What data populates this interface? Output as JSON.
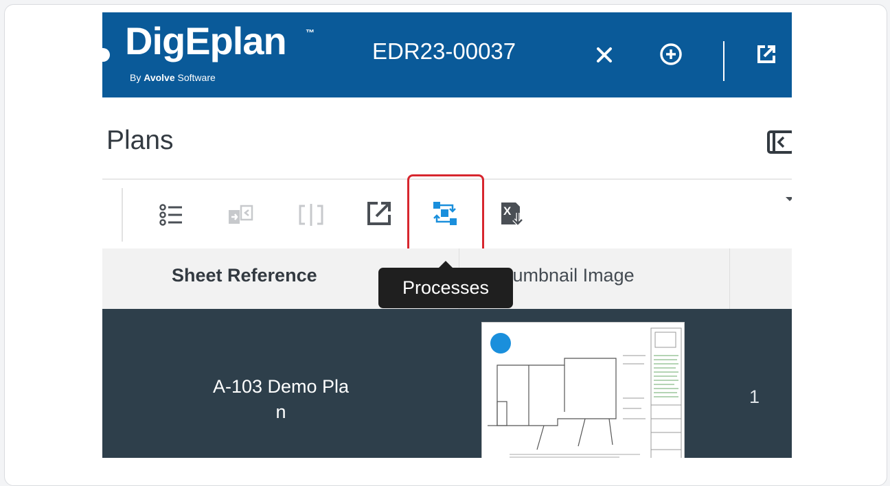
{
  "app": {
    "logo_name": "DigEplan",
    "logo_tm": "™",
    "logo_by_prefix": "By ",
    "logo_by_brand": "Avolve",
    "logo_by_suffix": " Software",
    "record_id": "EDR23-00037"
  },
  "page": {
    "title": "Plans"
  },
  "toolbar": {
    "icons": [
      "list-icon",
      "compare-icon",
      "split-view-icon",
      "open-external-icon",
      "processes-icon",
      "excel-export-icon"
    ],
    "highlighted": "processes-icon"
  },
  "tooltip": {
    "text": "Processes"
  },
  "table": {
    "columns": [
      {
        "label": "Sheet Reference"
      },
      {
        "label": "Thumbnail Image"
      }
    ],
    "rows": [
      {
        "sheet_ref_line1": "A-103 Demo Pla",
        "sheet_ref_line2": "n",
        "count": "1"
      }
    ]
  },
  "colors": {
    "header_bg": "#0a5a99",
    "row_bg": "#2e3f4b",
    "highlight": "#d7262e",
    "accent": "#1a8fdc"
  }
}
